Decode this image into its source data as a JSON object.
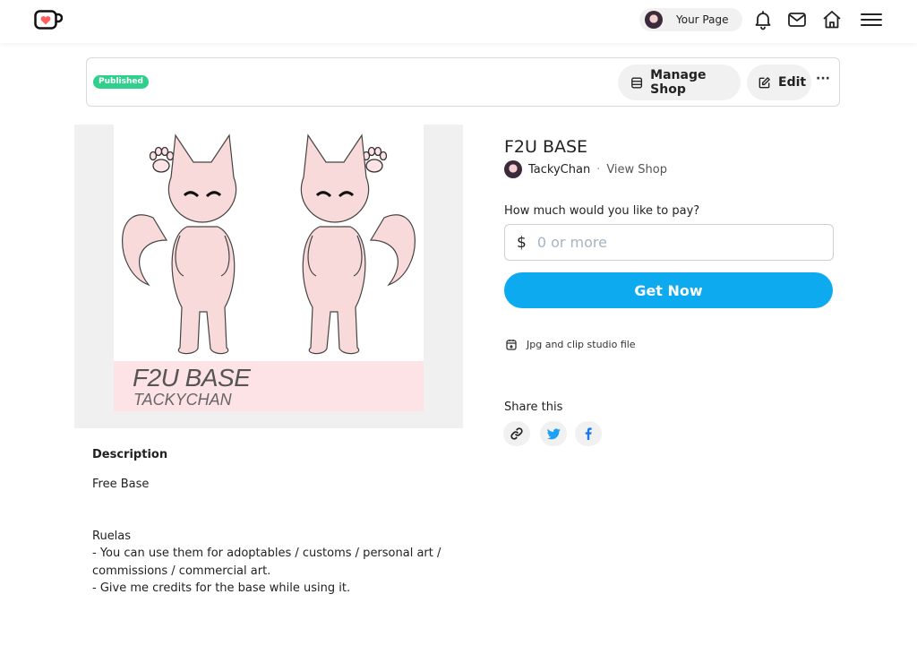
{
  "nav": {
    "your_page_label": "Your Page"
  },
  "admin": {
    "status_badge": "Published",
    "manage_shop_label": "Manage Shop",
    "edit_label": "Edit",
    "more_label": "···"
  },
  "artwork": {
    "title": "F2U BASE",
    "subtitle": "TACKYCHAN"
  },
  "product": {
    "title": "F2U BASE",
    "creator_name": "TackyChan",
    "separator": "·",
    "view_shop_label": "View Shop",
    "pay_label": "How much would you like to pay?",
    "currency_symbol": "$",
    "pay_placeholder": "0 or more",
    "cta_label": "Get Now",
    "file_info": "Jpg and clip studio file",
    "share_label": "Share this"
  },
  "description": {
    "heading": "Description",
    "lines": [
      "Free Base",
      "Ruelas",
      "- You can use them for adoptables / customs / personal art /",
      "commissions / commercial art.",
      "- Give me credits for the base while using it."
    ]
  },
  "colors": {
    "accent": "#0eaaf0",
    "badge": "#2fcf8c",
    "logo_red": "#ff5e5b"
  },
  "icons": [
    "kofi-logo-icon",
    "avatar",
    "bell-icon",
    "mail-icon",
    "home-icon",
    "menu-icon",
    "shop-icon",
    "edit-icon",
    "more-icon",
    "file-icon",
    "link-icon",
    "twitter-icon",
    "facebook-icon"
  ]
}
